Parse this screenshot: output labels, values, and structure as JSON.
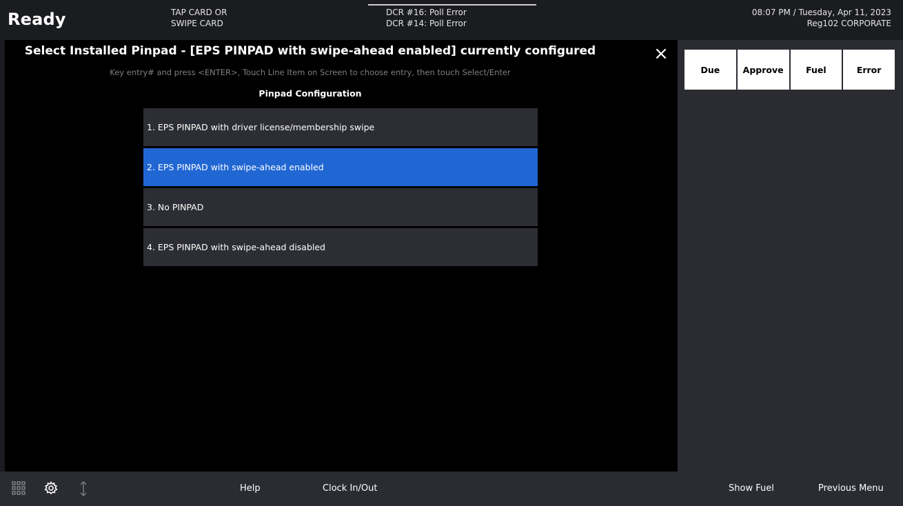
{
  "header": {
    "status": "Ready",
    "message1": [
      "TAP CARD OR",
      "SWIPE CARD"
    ],
    "message2": [
      "DCR #16: Poll Error",
      "DCR #14: Poll Error"
    ],
    "datetime": "08:07 PM / Tuesday, Apr 11, 2023",
    "register": "Reg102  CORPORATE"
  },
  "dialog": {
    "title": "Select Installed Pinpad - [EPS PINPAD with swipe-ahead enabled] currently configured",
    "instructions": "Key entry# and press <ENTER>, Touch Line Item on Screen to choose entry, then touch Select/Enter",
    "heading": "Pinpad Configuration",
    "close_icon": "×",
    "options": [
      {
        "label": "1. EPS PINPAD with driver license/membership swipe",
        "selected": false
      },
      {
        "label": "2. EPS PINPAD with swipe-ahead enabled",
        "selected": true
      },
      {
        "label": "3. No PINPAD",
        "selected": false
      },
      {
        "label": "4. EPS PINPAD with swipe-ahead disabled",
        "selected": false
      }
    ],
    "selected_color": "#2167d4"
  },
  "side_tabs": [
    "Due",
    "Approve",
    "Fuel",
    "Error"
  ],
  "footer": {
    "icons": [
      "grid-icon",
      "gear-icon",
      "updown-arrow-icon"
    ],
    "help": "Help",
    "clock": "Clock In/Out",
    "show_fuel": "Show Fuel",
    "previous_menu": "Previous Menu"
  }
}
